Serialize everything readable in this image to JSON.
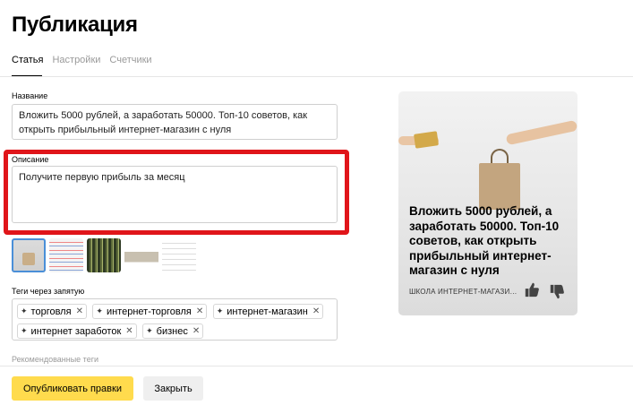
{
  "page": {
    "title": "Публикация"
  },
  "tabs": [
    {
      "label": "Статья",
      "active": true
    },
    {
      "label": "Настройки",
      "active": false
    },
    {
      "label": "Счетчики",
      "active": false
    }
  ],
  "form": {
    "name_label": "Название",
    "name_value": "Вложить 5000 рублей, а заработать 50000. Топ-10 советов, как открыть прибыльный интернет-магазин с нуля",
    "description_label": "Описание",
    "description_value": "Получите первую прибыль за месяц",
    "tags_label": "Теги через запятую",
    "tags": [
      "торговля",
      "интернет-торговля",
      "интернет-магазин",
      "интернет заработок",
      "бизнес"
    ],
    "recommended_label": "Рекомендованные теги"
  },
  "colors": {
    "highlight": "#e0151a",
    "primary_button": "#ffdb4d"
  },
  "icons": {
    "tag_prefix": "plus-icon",
    "tag_remove": "close-icon",
    "like": "thumbs-up-icon",
    "dislike": "thumbs-down-icon"
  },
  "preview": {
    "title": "Вложить 5000 рублей, а заработать 50000. Топ-10 советов, как открыть прибыльный интернет-магазин с нуля",
    "source": "ШКОЛА ИНТЕРНЕТ-МАГАЗИН..."
  },
  "footer": {
    "publish_label": "Опубликовать правки",
    "close_label": "Закрыть"
  }
}
